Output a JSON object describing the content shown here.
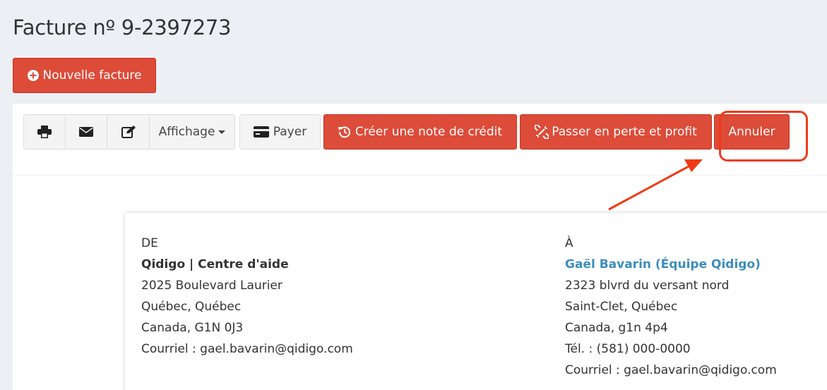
{
  "page": {
    "title": "Facture nº 9-2397273"
  },
  "actions": {
    "new_invoice": "Nouvelle facture"
  },
  "toolbar": {
    "print_icon": "print-icon",
    "email_icon": "envelope-icon",
    "edit_icon": "edit-icon",
    "display_label": "Affichage",
    "pay_label": "Payer",
    "credit_note_label": "Créer une note de crédit",
    "write_off_label": "Passer en perte et profit",
    "cancel_label": "Annuler"
  },
  "invoice": {
    "from": {
      "label": "DE",
      "name": "Qidigo | Centre d'aide",
      "street": "2025 Boulevard Laurier",
      "city": "Québec, Québec",
      "country_postal": "Canada, G1N 0J3",
      "email": "Courriel : gael.bavarin@qidigo.com"
    },
    "to": {
      "label": "À",
      "name": "Gaël Bavarin (Équipe Qidigo)",
      "street": "2323 blvrd du versant nord",
      "city": "Saint-Clet, Québec",
      "country_postal": "Canada, g1n 4p4",
      "phone": "Tél. : (581) 000-0000",
      "email": "Courriel : gael.bavarin@qidigo.com"
    }
  },
  "colors": {
    "danger": "#dd4b39",
    "link": "#3c8dbc",
    "annotation": "#f03a17",
    "background": "#ecf0f5"
  }
}
